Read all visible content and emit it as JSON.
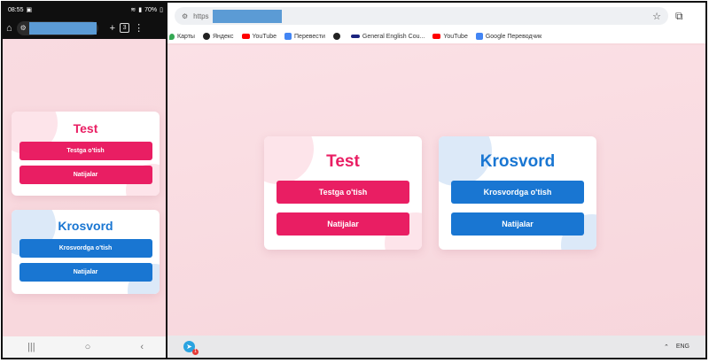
{
  "phone": {
    "status": {
      "time": "08:55",
      "battery": "70%"
    },
    "toolbar": {
      "tab_count": "3"
    },
    "cards": {
      "test": {
        "title": "Test",
        "primary": "Testga o'tish",
        "secondary": "Natijalar"
      },
      "krosvord": {
        "title": "Krosvord",
        "primary": "Krosvordga o'tish",
        "secondary": "Natijalar"
      }
    }
  },
  "desktop": {
    "omnibox": {
      "scheme": "https"
    },
    "bookmarks": [
      {
        "label": "Карты",
        "icon": "maps-pin-icon"
      },
      {
        "label": "Яндекс",
        "icon": "globe-icon"
      },
      {
        "label": "YouTube",
        "icon": "youtube-icon"
      },
      {
        "label": "Перевести",
        "icon": "translate-icon"
      },
      {
        "label": "",
        "icon": "globe-icon"
      },
      {
        "label": "General English Cou...",
        "icon": "site-icon"
      },
      {
        "label": "YouTube",
        "icon": "youtube-icon"
      },
      {
        "label": "Google Переводчик",
        "icon": "translate-icon"
      }
    ],
    "cards": {
      "test": {
        "title": "Test",
        "primary": "Testga o'tish",
        "secondary": "Natijalar"
      },
      "krosvord": {
        "title": "Krosvord",
        "primary": "Krosvordga o'tish",
        "secondary": "Natijalar"
      }
    },
    "taskbar": {
      "telegram_badge": "1",
      "language": "ENG"
    }
  },
  "colors": {
    "accent_pink": "#e91e63",
    "accent_blue": "#1976d2",
    "page_bg": "#f8d7dc"
  }
}
